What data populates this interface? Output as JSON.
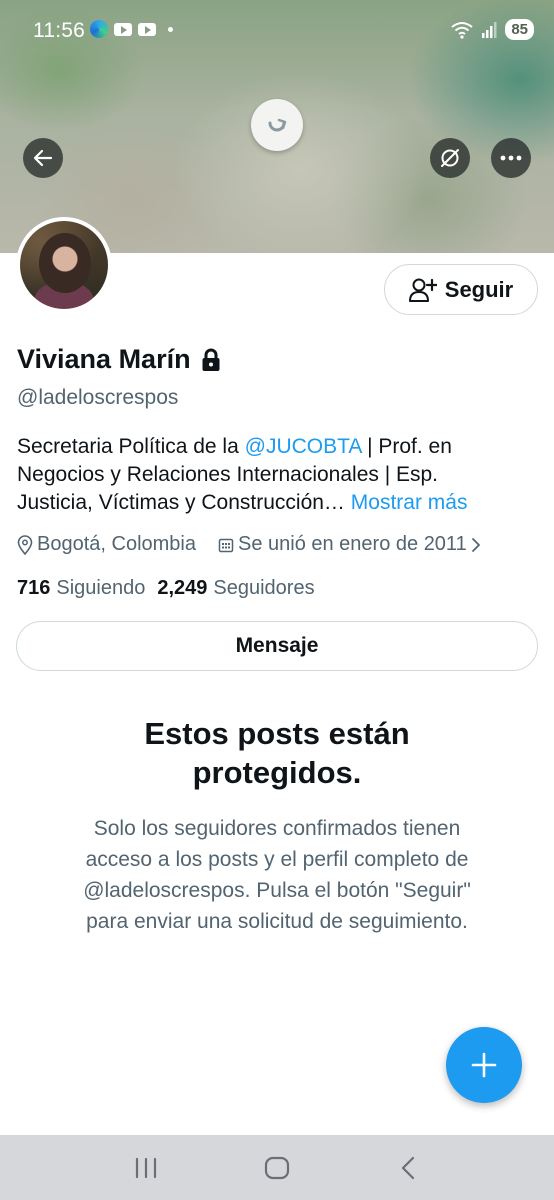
{
  "status_bar": {
    "time": "11:56",
    "battery": "85",
    "icons": [
      "edge-icon",
      "youtube-icon",
      "youtube-icon",
      "dot-icon",
      "wifi-icon",
      "signal-icon"
    ]
  },
  "header": {
    "icons": [
      "back-arrow-icon",
      "refresh-icon",
      "translate-off-icon",
      "more-icon"
    ]
  },
  "profile": {
    "follow_label": "Seguir",
    "name": "Viviana Marín",
    "handle": "@ladeloscrespos",
    "bio": {
      "line1_prefix": "Secretaria Política de la ",
      "mention": "@JUCOBTA",
      "line1_suffix": " | Prof. en",
      "line2": "Negocios y Relaciones Internacionales | Esp.",
      "line3": "Justicia, Víctimas y Construcción… ",
      "more_label": "Mostrar más"
    },
    "location": "Bogotá, Colombia",
    "joined": "Se unió en enero de 2011",
    "following_count": "716",
    "following_label": "Siguiendo",
    "followers_count": "2,249",
    "followers_label": "Seguidores",
    "message_label": "Mensaje"
  },
  "protected": {
    "title_line1": "Estos posts están",
    "title_line2": "protegidos.",
    "text_line1": "Solo los seguidores confirmados tienen",
    "text_line2": "acceso a los posts y el perfil completo de",
    "text_line3": "@ladeloscrespos. Pulsa el botón \"Seguir\"",
    "text_line4": "para enviar una solicitud de seguimiento."
  },
  "fab": {
    "icon": "plus-icon"
  },
  "colors": {
    "accent": "#1d9bf0",
    "text_primary": "#0f1419",
    "text_secondary": "#536471",
    "border": "#cfd9de"
  }
}
